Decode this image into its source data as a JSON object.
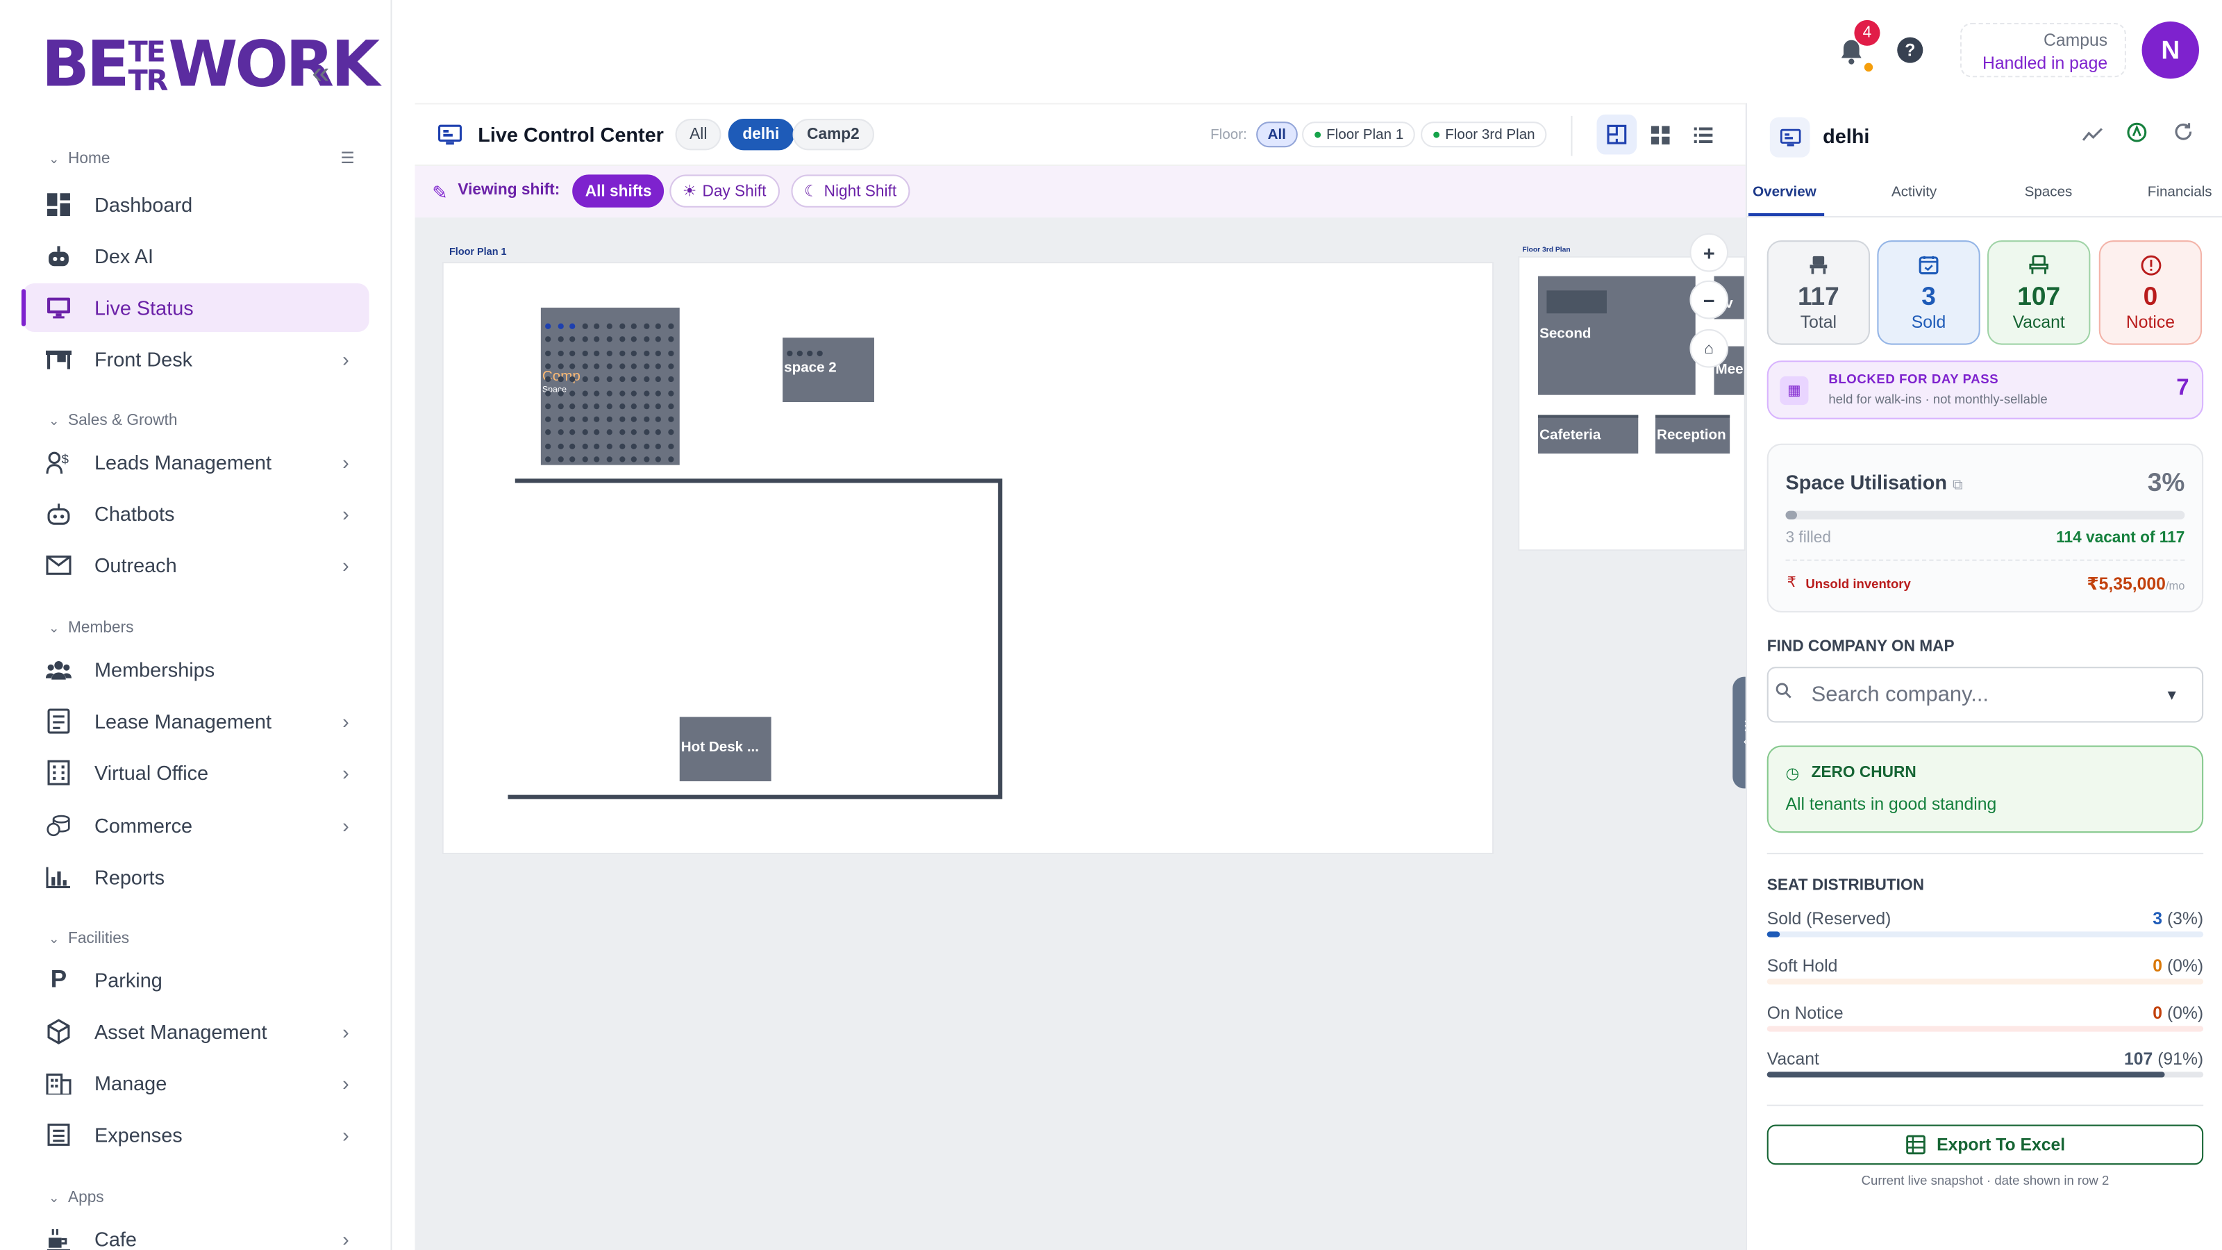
{
  "brand": {
    "logo_left": "BE",
    "logo_top": "TE",
    "logo_bot": "TR",
    "logo_right": "WORK"
  },
  "sidebar": {
    "sections": [
      {
        "label": "Home"
      },
      {
        "label": "Sales & Growth"
      },
      {
        "label": "Members"
      },
      {
        "label": "Facilities"
      },
      {
        "label": "Apps"
      }
    ],
    "items": [
      {
        "label": "Dashboard",
        "icon": "dashboard-icon"
      },
      {
        "label": "Dex AI",
        "icon": "robot-icon"
      },
      {
        "label": "Live Status",
        "icon": "monitor-icon",
        "active": true
      },
      {
        "label": "Front Desk",
        "icon": "desk-icon"
      },
      {
        "label": "Leads Management",
        "icon": "leads-icon"
      },
      {
        "label": "Chatbots",
        "icon": "bot-icon"
      },
      {
        "label": "Outreach",
        "icon": "mail-icon"
      },
      {
        "label": "Memberships",
        "icon": "people-icon"
      },
      {
        "label": "Lease Management",
        "icon": "document-icon"
      },
      {
        "label": "Virtual Office",
        "icon": "building-icon"
      },
      {
        "label": "Commerce",
        "icon": "coins-icon"
      },
      {
        "label": "Reports",
        "icon": "chart-icon"
      },
      {
        "label": "Parking",
        "icon": "parking-icon"
      },
      {
        "label": "Asset Management",
        "icon": "box-icon"
      },
      {
        "label": "Manage",
        "icon": "office-icon"
      },
      {
        "label": "Expenses",
        "icon": "receipt-icon"
      },
      {
        "label": "Cafe",
        "icon": "cafe-icon"
      }
    ]
  },
  "topbar": {
    "notif_count": "4",
    "help": "?",
    "campus_label": "Campus",
    "campus_value": "Handled in page",
    "avatar": "N"
  },
  "control": {
    "title": "Live Control Center",
    "locations": [
      "All",
      "delhi",
      "Camp2"
    ],
    "floor_label": "Floor:",
    "floors": [
      "All",
      "Floor Plan 1",
      "Floor 3rd Plan"
    ],
    "shift_label": "Viewing shift:",
    "shifts": [
      "All shifts",
      "Day Shift",
      "Night Shift"
    ]
  },
  "map": {
    "plan1_label": "Floor Plan 1",
    "plan2_label": "Floor 3rd Plan",
    "rooms": {
      "comp": "Comp",
      "comp_sub": "Space",
      "space2": "space 2",
      "hotdesk": "Hot Desk ...",
      "second": "Second",
      "cafeteria": "Cafeteria",
      "reception": "Reception",
      "priv": "riv",
      "meet": "Mee"
    },
    "zoom_in": "+",
    "zoom_out": "−",
    "home": "⌂"
  },
  "panel": {
    "title": "delhi",
    "tabs": [
      "Overview",
      "Activity",
      "Spaces",
      "Financials"
    ],
    "stats": [
      {
        "value": "117",
        "label": "Total",
        "color": "#4b5563"
      },
      {
        "value": "3",
        "label": "Sold",
        "color": "#1e5bb8"
      },
      {
        "value": "107",
        "label": "Vacant",
        "color": "#166534"
      },
      {
        "value": "0",
        "label": "Notice",
        "color": "#b91c1c"
      }
    ],
    "blocked": {
      "title": "BLOCKED FOR DAY PASS",
      "sub": "held for walk-ins · not monthly-sellable",
      "value": "7"
    },
    "util": {
      "title": "Space Utilisation",
      "pct": "3%",
      "fill": 0.03,
      "filled": "3 filled",
      "vacant": "114 vacant of 117",
      "unsold_label": "Unsold inventory",
      "unsold_value": "₹5,35,000",
      "per": "/mo"
    },
    "find": {
      "label": "FIND COMPANY ON MAP",
      "placeholder": "Search company..."
    },
    "churn": {
      "title": "ZERO CHURN",
      "sub": "All tenants in good standing"
    },
    "dist": {
      "label": "SEAT DISTRIBUTION",
      "rows": [
        {
          "label": "Sold (Reserved)",
          "value": "3",
          "pct": "(3%)",
          "fill": 0.03,
          "color": "#1e5bb8",
          "track": "#e6eef9"
        },
        {
          "label": "Soft Hold",
          "value": "0",
          "pct": "(0%)",
          "fill": 0,
          "color": "#d97706",
          "track": "#fdf0e6"
        },
        {
          "label": "On Notice",
          "value": "0",
          "pct": "(0%)",
          "fill": 0,
          "color": "#c2410c",
          "track": "#fde8e6"
        },
        {
          "label": "Vacant",
          "value": "107",
          "pct": "(91%)",
          "fill": 0.91,
          "color": "#475569",
          "track": "#e5e7eb"
        }
      ]
    },
    "export": "Export To Excel",
    "footnote": "Current live snapshot · date shown in row 2"
  }
}
